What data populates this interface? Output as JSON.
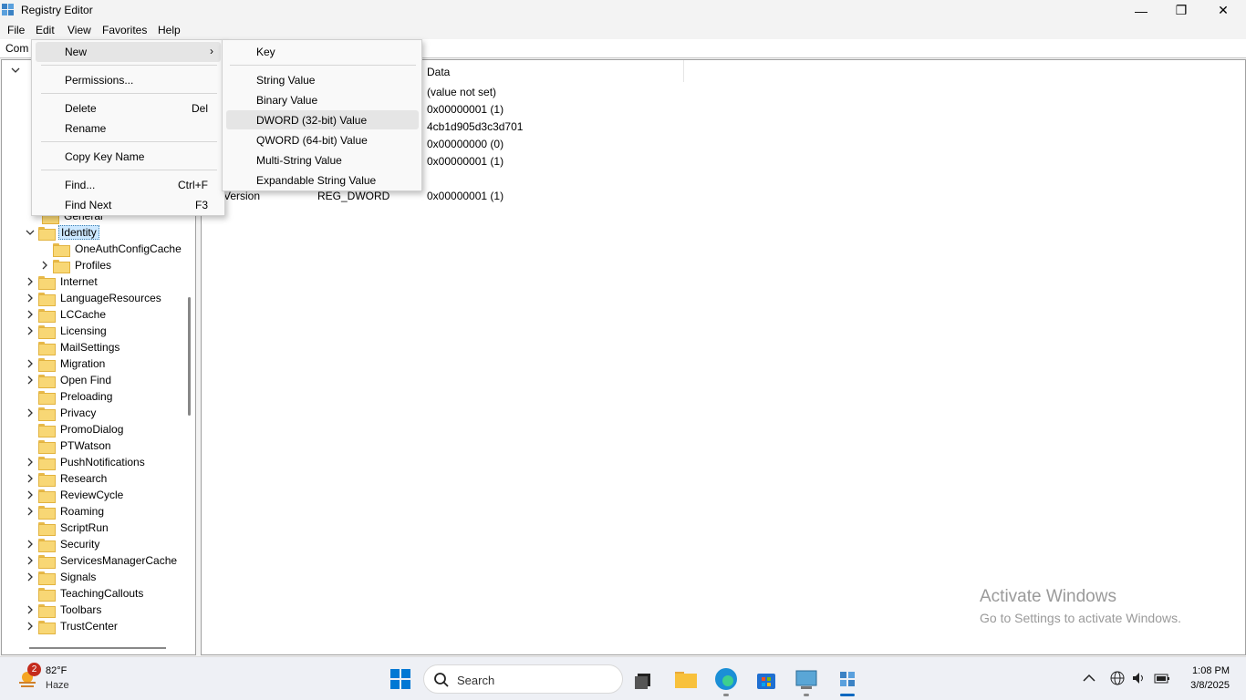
{
  "window": {
    "title": "Registry Editor",
    "minimize_glyph": "—",
    "maximize_glyph": "❐",
    "close_glyph": "✕"
  },
  "menubar": {
    "file": "File",
    "edit": "Edit",
    "view": "View",
    "favorites": "Favorites",
    "help": "Help"
  },
  "address": {
    "text": "Com"
  },
  "tree": {
    "items": [
      {
        "label": "General"
      },
      {
        "label": "Identity"
      },
      {
        "label": "OneAuthConfigCache"
      },
      {
        "label": "Profiles"
      },
      {
        "label": "Internet"
      },
      {
        "label": "LanguageResources"
      },
      {
        "label": "LCCache"
      },
      {
        "label": "Licensing"
      },
      {
        "label": "MailSettings"
      },
      {
        "label": "Migration"
      },
      {
        "label": "Open Find"
      },
      {
        "label": "Preloading"
      },
      {
        "label": "Privacy"
      },
      {
        "label": "PromoDialog"
      },
      {
        "label": "PTWatson"
      },
      {
        "label": "PushNotifications"
      },
      {
        "label": "Research"
      },
      {
        "label": "ReviewCycle"
      },
      {
        "label": "Roaming"
      },
      {
        "label": "ScriptRun"
      },
      {
        "label": "Security"
      },
      {
        "label": "ServicesManagerCache"
      },
      {
        "label": "Signals"
      },
      {
        "label": "TeachingCallouts"
      },
      {
        "label": "Toolbars"
      },
      {
        "label": "TrustCenter"
      }
    ]
  },
  "list": {
    "data_header": "Data",
    "rows": [
      {
        "name": "",
        "type": "",
        "data": "(value not set)"
      },
      {
        "name": "",
        "type": "",
        "data": "0x00000001 (1)"
      },
      {
        "name": "",
        "type": "",
        "data": "4cb1d905d3c3d701"
      },
      {
        "name": "",
        "type": "",
        "data": "0x00000000 (0)"
      },
      {
        "name": "",
        "type": "",
        "data": "0x00000001 (1)"
      },
      {
        "name": "Version",
        "type": "REG_DWORD",
        "data": "0x00000001 (1)"
      }
    ]
  },
  "edit_menu": {
    "new": "New",
    "permissions": "Permissions...",
    "delete": "Delete",
    "delete_shortcut": "Del",
    "rename": "Rename",
    "copy_key_name": "Copy Key Name",
    "find": "Find...",
    "find_shortcut": "Ctrl+F",
    "find_next": "Find Next",
    "find_next_shortcut": "F3"
  },
  "new_menu": {
    "key": "Key",
    "string_value": "String Value",
    "binary_value": "Binary Value",
    "dword_value": "DWORD (32-bit) Value",
    "qword_value": "QWORD (64-bit) Value",
    "multi_string_value": "Multi-String Value",
    "expandable_string_value": "Expandable String Value"
  },
  "watermark": {
    "line1": "Activate Windows",
    "line2": "Go to Settings to activate Windows."
  },
  "taskbar": {
    "weather_badge": "2",
    "temperature": "82°F",
    "condition": "Haze",
    "search_label": "Search",
    "time": "1:08 PM",
    "date": "3/8/2025"
  },
  "colors": {
    "selection": "#cce8ff",
    "folder": "#f8d775",
    "accent": "#0067c0"
  }
}
